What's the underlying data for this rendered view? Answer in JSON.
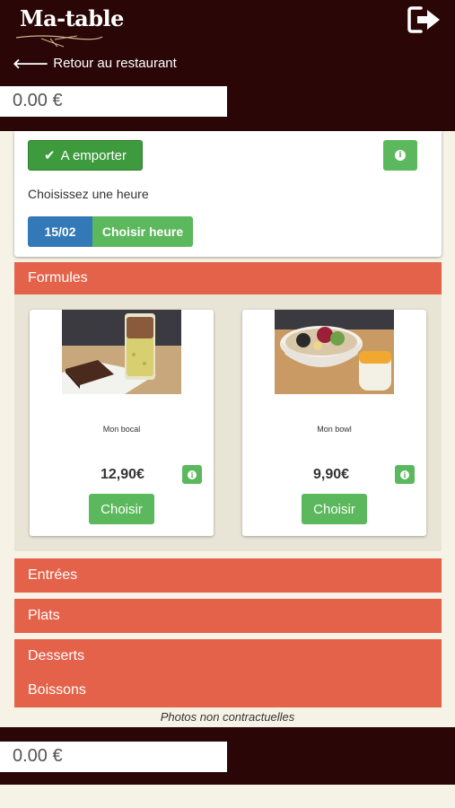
{
  "header": {
    "logo_text": "Ma-table",
    "back_label": "Retour au restaurant",
    "total": "0.00 €"
  },
  "order": {
    "mode_label": "A emporter",
    "choose_hour_prompt": "Choisissez une heure",
    "date": "15/02",
    "choose_hour_button": "Choisir heure"
  },
  "categories": {
    "formules": "Formules",
    "entrees": "Entrées",
    "plats": "Plats",
    "desserts": "Desserts",
    "boissons": "Boissons"
  },
  "products": [
    {
      "name": "Mon bocal",
      "price": "12,90€",
      "button": "Choisir"
    },
    {
      "name": "Mon bowl",
      "price": "9,90€",
      "button": "Choisir"
    }
  ],
  "disclaimer": "Photos non contractuelles",
  "footer": {
    "total": "0.00 €"
  },
  "colors": {
    "header_bg": "#2a0606",
    "category_bar": "#e5624a",
    "green_button": "#5cb85c",
    "blue_button": "#3379b8"
  }
}
